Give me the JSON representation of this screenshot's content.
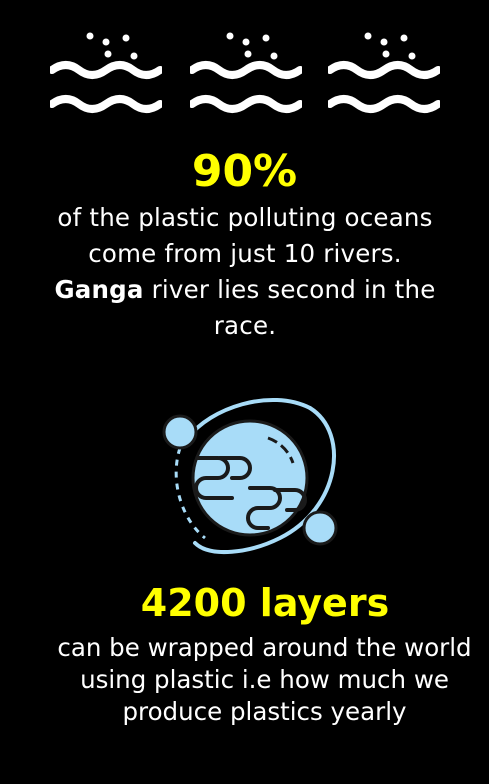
{
  "colors": {
    "background": "#000000",
    "highlight": "#ffff00",
    "text": "#ffffff",
    "globe_fill": "#a8dcf8",
    "globe_stroke": "#1a1a1a"
  },
  "icons": {
    "waves": "waves-icon",
    "globe": "planet-orbit-icon"
  },
  "fact1": {
    "stat": "90%",
    "text_before": "of the plastic polluting oceans come from just 10 rivers. ",
    "highlight": "Ganga",
    "text_after": " river lies second in the race."
  },
  "fact2": {
    "stat": "4200 layers",
    "text": "can be wrapped around the world using plastic i.e how much we produce plastics yearly"
  }
}
